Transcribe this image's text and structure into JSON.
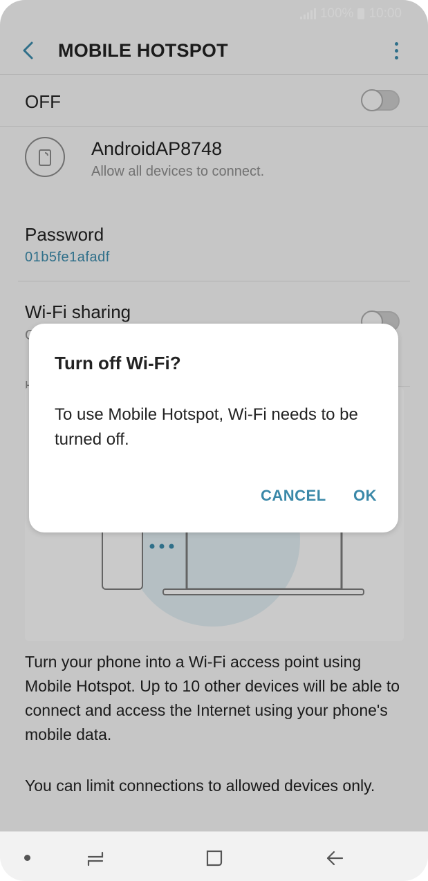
{
  "status_bar": {
    "battery": "100%",
    "time": "10:00"
  },
  "header": {
    "title": "MOBILE HOTSPOT"
  },
  "master_switch": {
    "label": "OFF"
  },
  "network": {
    "name": "AndroidAP8748",
    "subtitle": "Allow all devices to connect."
  },
  "password": {
    "label": "Password",
    "value": "01b5fe1afadf"
  },
  "wifi_sharing": {
    "label": "Wi-Fi sharing",
    "subtitle_visible": "O",
    "section_initial": "H"
  },
  "description": {
    "p1": "Turn your phone into a Wi-Fi access point using Mobile Hotspot. Up to 10 other devices will be able to connect and access the Internet using your phone's mobile data.",
    "p2": "You can limit connections to allowed devices only."
  },
  "dialog": {
    "title": "Turn off Wi-Fi?",
    "body": "To use Mobile Hotspot, Wi-Fi needs to be turned off.",
    "cancel_label": "CANCEL",
    "ok_label": "OK"
  },
  "colors": {
    "accent": "#3a88a8",
    "text": "#222222",
    "secondary": "#8a8a8a"
  }
}
